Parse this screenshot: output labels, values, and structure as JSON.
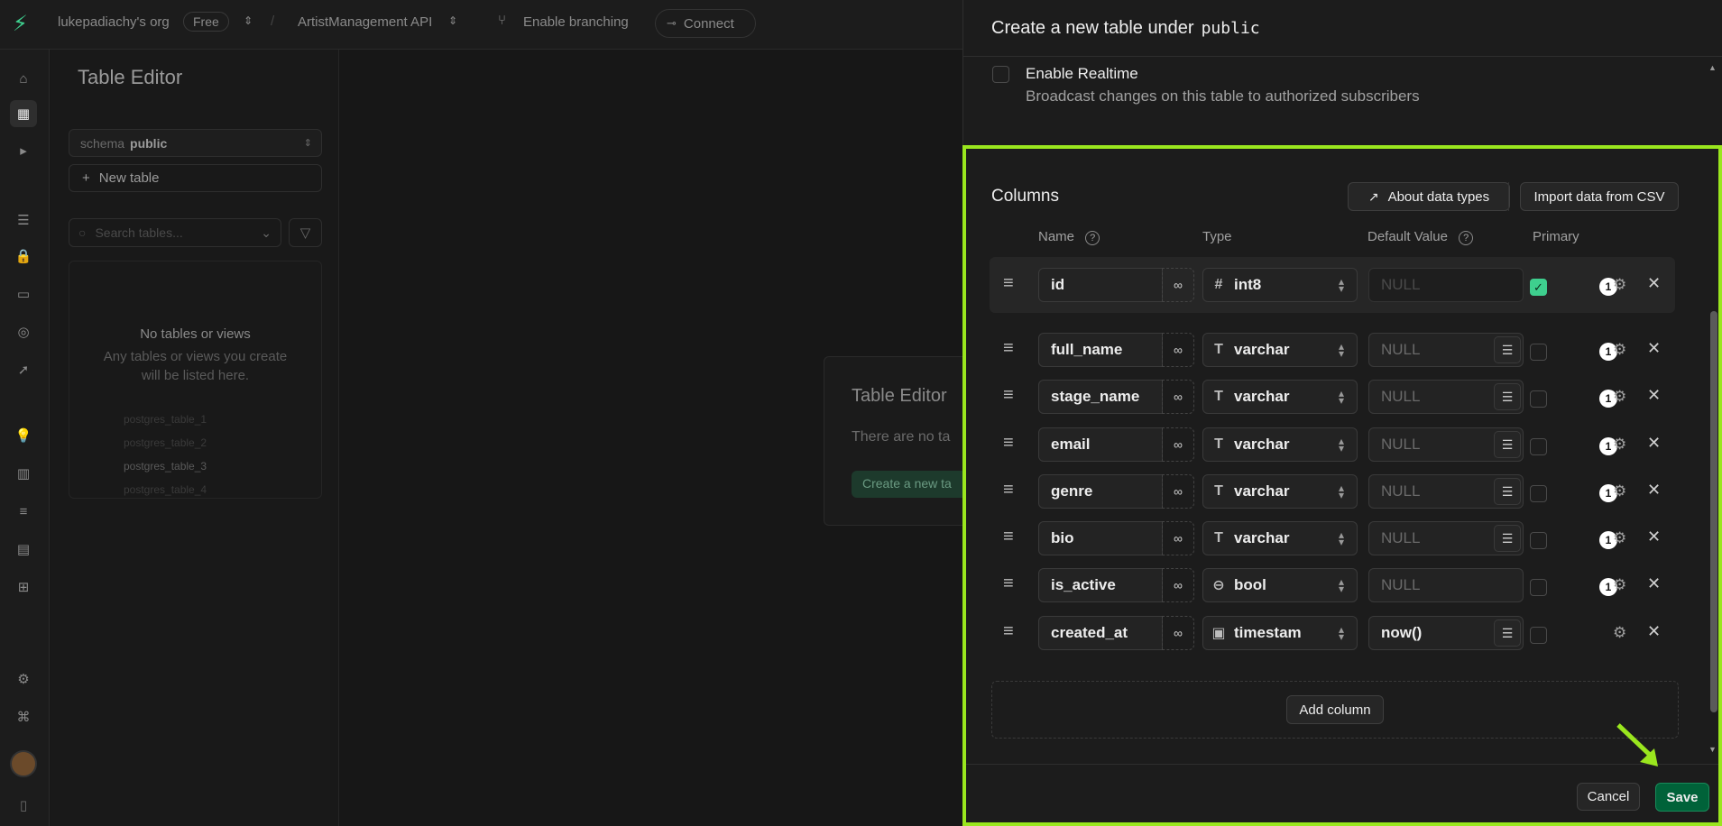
{
  "topbar": {
    "org": "lukepadiachy's org",
    "plan": "Free",
    "project": "ArtistManagement API",
    "branching": "Enable branching",
    "connect": "Connect"
  },
  "sidebar": {
    "title": "Table Editor",
    "schema_label": "schema",
    "schema_value": "public",
    "new_table": "New table",
    "search_placeholder": "Search tables...",
    "empty_title": "No tables or views",
    "empty_desc_1": "Any tables or views you create",
    "empty_desc_2": "will be listed here.",
    "ghost_items": [
      "postgres_table_1",
      "postgres_table_2",
      "postgres_table_3",
      "postgres_table_4"
    ]
  },
  "main": {
    "card_title": "Table Editor",
    "card_desc": "There are no ta",
    "card_button": "Create a new ta"
  },
  "modal": {
    "title_prefix": "Create a new table under",
    "schema": "public",
    "realtime_label": "Enable Realtime",
    "realtime_desc": "Broadcast changes on this table to authorized subscribers",
    "columns_title": "Columns",
    "about_types": "About data types",
    "import_csv": "Import data from CSV",
    "headers": {
      "name": "Name",
      "type": "Type",
      "default": "Default Value",
      "primary": "Primary"
    },
    "rows": [
      {
        "name": "id",
        "type": "int8",
        "type_icon": "#",
        "default": "NULL",
        "default_filled": false,
        "primary": true,
        "badge": "1",
        "has_list": false
      },
      {
        "name": "full_name",
        "type": "varchar",
        "type_icon": "T",
        "default": "NULL",
        "default_filled": false,
        "primary": false,
        "badge": "1",
        "has_list": true
      },
      {
        "name": "stage_name",
        "type": "varchar",
        "type_icon": "T",
        "default": "NULL",
        "default_filled": false,
        "primary": false,
        "badge": "1",
        "has_list": true
      },
      {
        "name": "email",
        "type": "varchar",
        "type_icon": "T",
        "default": "NULL",
        "default_filled": false,
        "primary": false,
        "badge": "1",
        "has_list": true
      },
      {
        "name": "genre",
        "type": "varchar",
        "type_icon": "T",
        "default": "NULL",
        "default_filled": false,
        "primary": false,
        "badge": "1",
        "has_list": true
      },
      {
        "name": "bio",
        "type": "varchar",
        "type_icon": "T",
        "default": "NULL",
        "default_filled": false,
        "primary": false,
        "badge": "1",
        "has_list": true
      },
      {
        "name": "is_active",
        "type": "bool",
        "type_icon": "toggle",
        "default": "NULL",
        "default_filled": false,
        "primary": false,
        "badge": "1",
        "has_list": false
      },
      {
        "name": "created_at",
        "type": "timestam",
        "type_icon": "calendar",
        "default": "now()",
        "default_filled": true,
        "primary": false,
        "badge": "",
        "has_list": true
      }
    ],
    "add_column": "Add column",
    "cancel": "Cancel",
    "save": "Save"
  },
  "colors": {
    "accent": "#3ecf8e",
    "highlight": "#9ae61e",
    "save_bg": "#006239"
  }
}
